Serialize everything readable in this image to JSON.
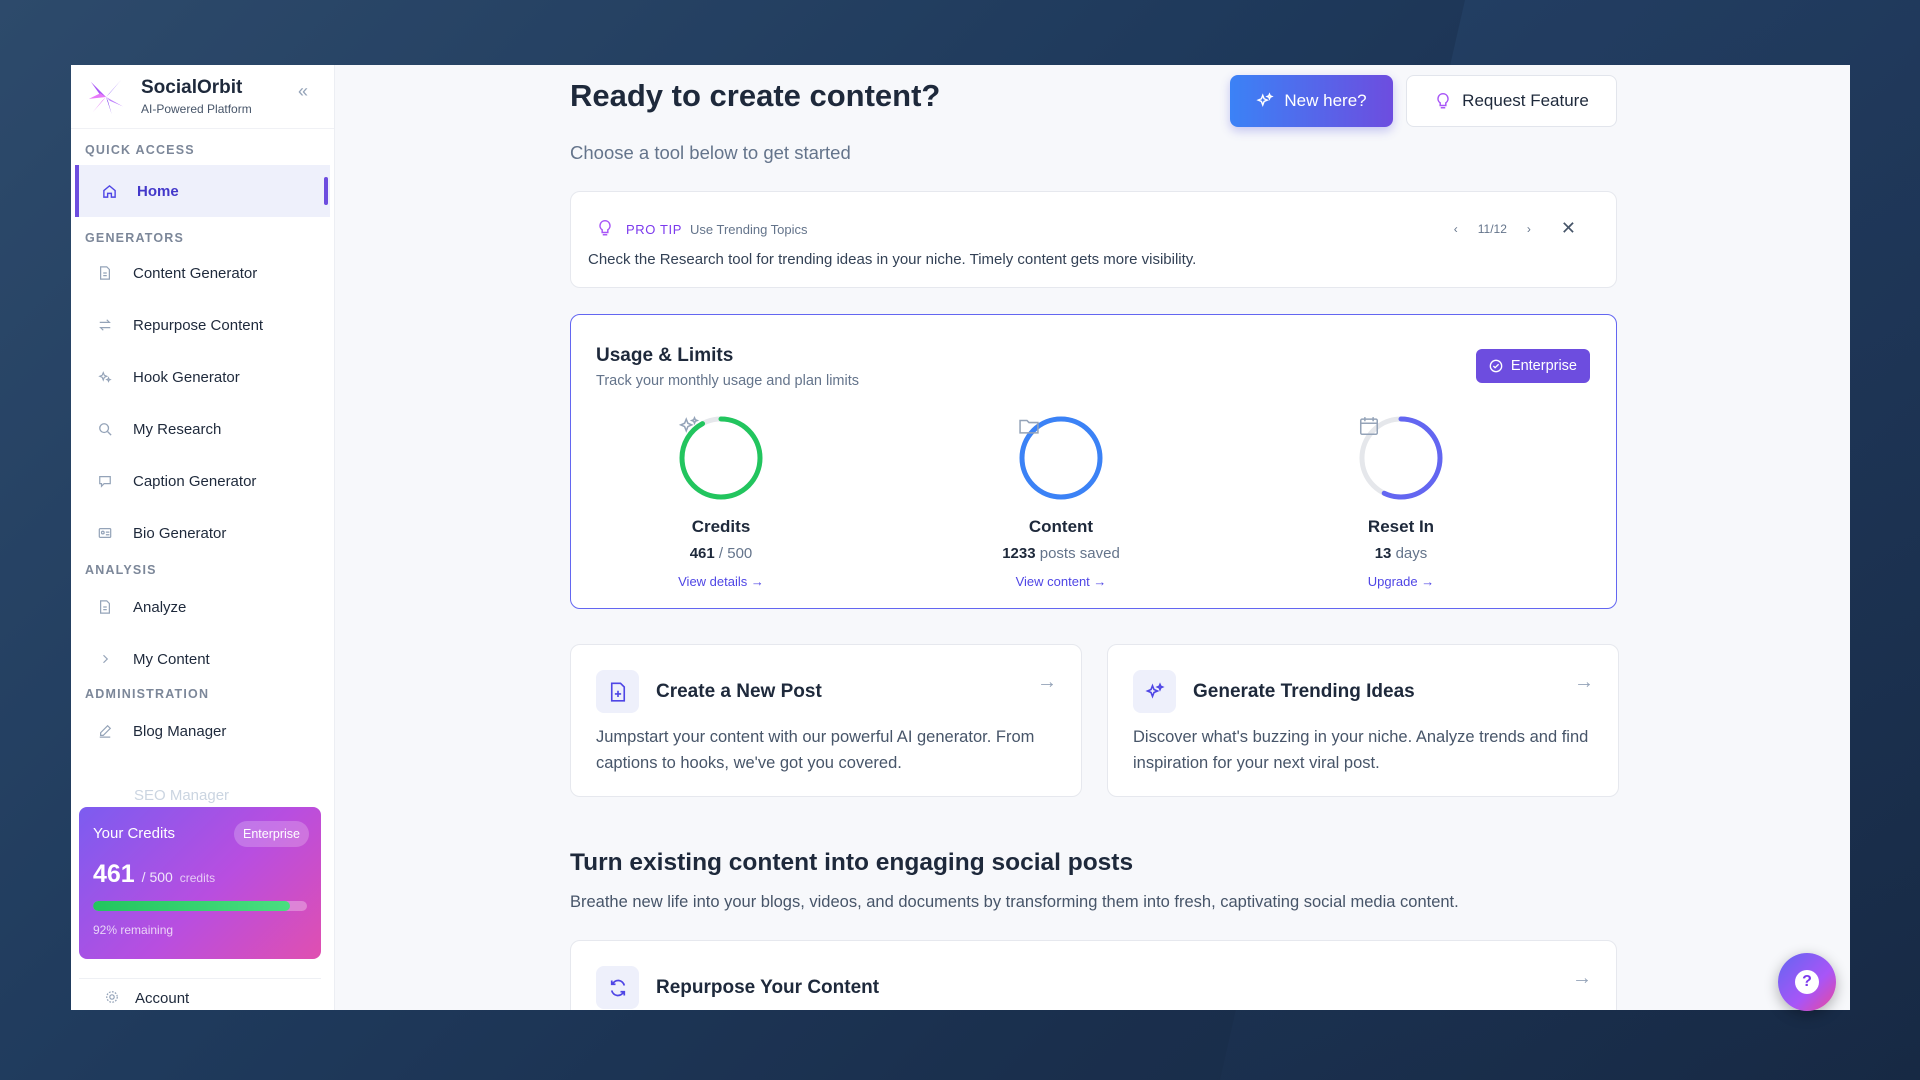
{
  "app": {
    "name": "SocialOrbit",
    "tagline": "AI-Powered Platform"
  },
  "sidebar": {
    "sections": {
      "quick_access": "QUICK ACCESS",
      "generators": "GENERATORS",
      "analysis": "ANALYSIS",
      "administration": "ADMINISTRATION"
    },
    "items": {
      "home": "Home",
      "content_generator": "Content Generator",
      "repurpose_content": "Repurpose Content",
      "hook_generator": "Hook Generator",
      "my_research": "My Research",
      "caption_generator": "Caption Generator",
      "bio_generator": "Bio Generator",
      "analyze": "Analyze",
      "my_content": "My Content",
      "blog_manager": "Blog Manager",
      "seo_manager": "SEO Manager",
      "account": "Account"
    },
    "credits": {
      "title": "Your Credits",
      "plan": "Enterprise",
      "used": "461",
      "total": "/ 500",
      "unit": "credits",
      "remaining_text": "92% remaining",
      "fill_fraction": 0.92
    }
  },
  "header": {
    "title": "Ready to create content?",
    "subtitle": "Choose a tool below to get started",
    "new_here": "New here?",
    "request_feature": "Request Feature"
  },
  "tip": {
    "label": "PRO TIP",
    "topic": "Use Trending Topics",
    "text": "Check the Research tool for trending ideas in your niche. Timely content gets more visibility.",
    "pager": "11/12"
  },
  "usage": {
    "title": "Usage & Limits",
    "subtitle": "Track your monthly usage and plan limits",
    "plan": "Enterprise",
    "stats": [
      {
        "label": "Credits",
        "value": "461",
        "value_suffix": " / 500",
        "link": "View details →",
        "color": "#22c55e",
        "fraction": 0.92
      },
      {
        "label": "Content",
        "value": "1233",
        "value_suffix": " posts saved",
        "link": "View content →",
        "color": "#3b82f6",
        "fraction": 1.0
      },
      {
        "label": "Reset In",
        "value": "13",
        "value_suffix": " days",
        "link": "Upgrade →",
        "color": "#6366f1",
        "fraction": 0.57
      }
    ]
  },
  "features": [
    {
      "title": "Create a New Post",
      "desc": "Jumpstart your content with our powerful AI generator. From captions to hooks, we've got you covered."
    },
    {
      "title": "Generate Trending Ideas",
      "desc": "Discover what's buzzing in your niche. Analyze trends and find inspiration for your next viral post."
    }
  ],
  "repurpose_section": {
    "title": "Turn existing content into engaging social posts",
    "desc": "Breathe new life into your blogs, videos, and documents by transforming them into fresh, captivating social media content.",
    "card_title": "Repurpose Your Content"
  },
  "colors": {
    "accent": "#6d4ddf",
    "primary_blue": "#3b82f6"
  }
}
